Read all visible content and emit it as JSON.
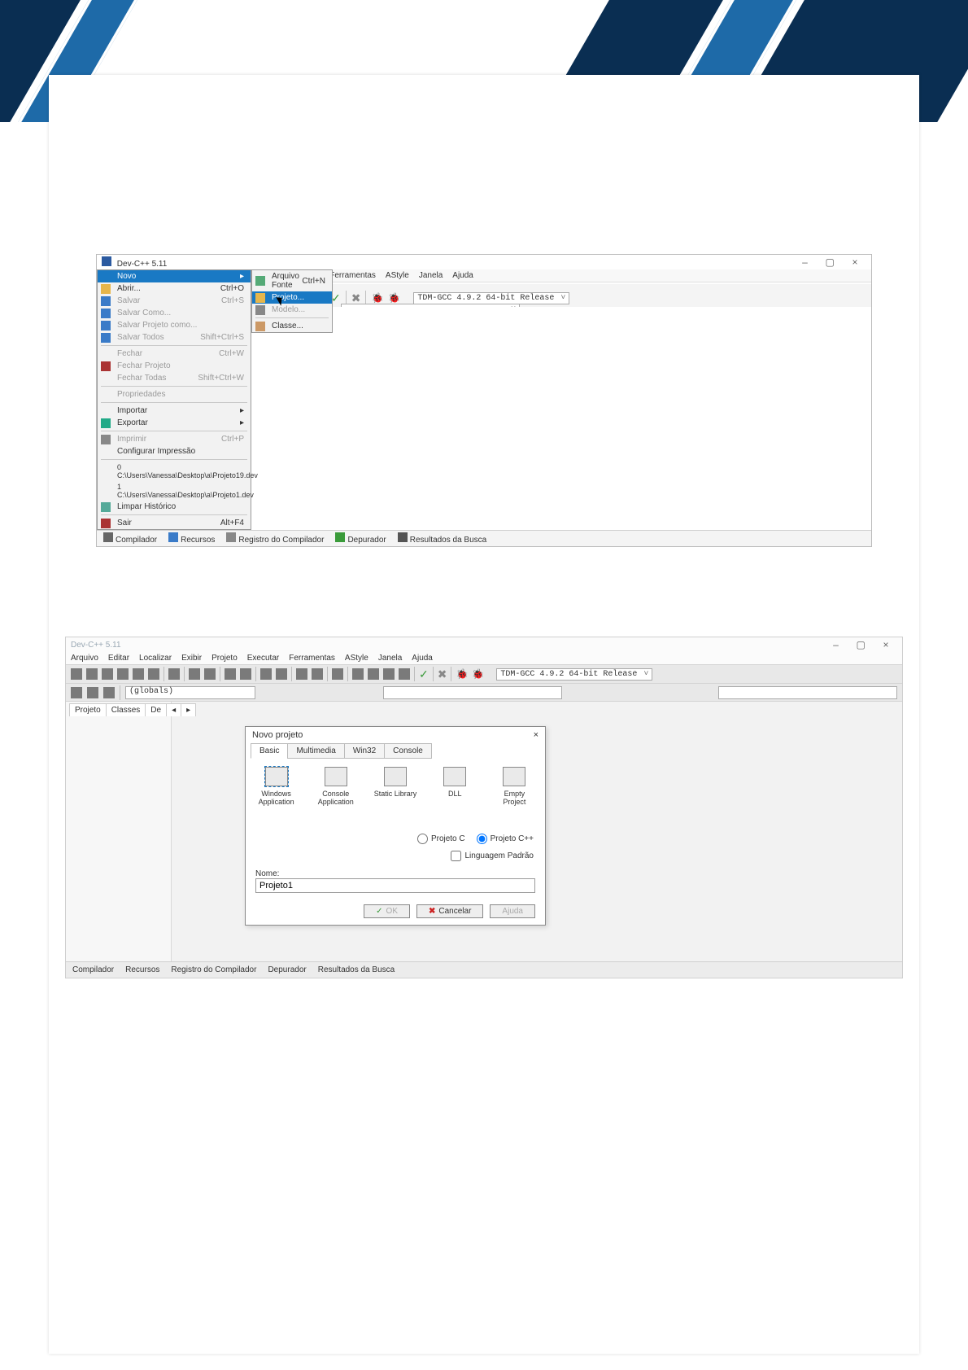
{
  "app_title": "Dev-C++ 5.11",
  "window_controls": {
    "min": "–",
    "max": "▢",
    "close": "×"
  },
  "menus": [
    "Arquivo",
    "Editar",
    "Localizar",
    "Exibir",
    "Projeto",
    "Executar",
    "Ferramentas",
    "AStyle",
    "Janela",
    "Ajuda"
  ],
  "compiler_selector": "TDM-GCC 4.9.2 64-bit Release",
  "bottom_tabs": [
    "Compilador",
    "Recursos",
    "Registro do Compilador",
    "Depurador",
    "Resultados da Busca"
  ],
  "file_menu": {
    "novo": "Novo",
    "abrir": "Abrir...",
    "abrir_sc": "Ctrl+O",
    "salvar": "Salvar",
    "salvar_sc": "Ctrl+S",
    "salvar_como": "Salvar Como...",
    "salvar_proj": "Salvar Projeto como...",
    "salvar_todos": "Salvar Todos",
    "salvar_todos_sc": "Shift+Ctrl+S",
    "fechar": "Fechar",
    "fechar_sc": "Ctrl+W",
    "fechar_proj": "Fechar Projeto",
    "fechar_todos": "Fechar Todas",
    "fechar_todos_sc": "Shift+Ctrl+W",
    "propriedades": "Propriedades",
    "importar": "Importar",
    "exportar": "Exportar",
    "imprimir": "Imprimir",
    "imprimir_sc": "Ctrl+P",
    "conf_impr": "Configurar Impressão",
    "recent0": "0 C:\\Users\\Vanessa\\Desktop\\a\\Projeto19.dev",
    "recent1": "1 C:\\Users\\Vanessa\\Desktop\\a\\Projeto1.dev",
    "limpar": "Limpar Histórico",
    "sair": "Sair",
    "sair_sc": "Alt+F4"
  },
  "novo_submenu": {
    "arquivo_fonte": "Arquivo Fonte",
    "arquivo_fonte_sc": "Ctrl+N",
    "projeto": "Projeto...",
    "modelo": "Modelo...",
    "classe": "Classe..."
  },
  "shot2": {
    "globals_label": "(globals)",
    "left_tabs": [
      "Projeto",
      "Classes",
      "De"
    ],
    "dialog": {
      "title": "Novo projeto",
      "tabs": [
        "Basic",
        "Multimedia",
        "Win32",
        "Console"
      ],
      "types": [
        "Windows Application",
        "Console Application",
        "Static Library",
        "DLL",
        "Empty Project"
      ],
      "opt_c": "Projeto C",
      "opt_cpp": "Projeto C++",
      "lang_default": "Linguagem Padrão",
      "name_label": "Nome:",
      "name_value": "Projeto1",
      "btn_ok": "OK",
      "btn_cancel": "Cancelar",
      "btn_help": "Ajuda"
    }
  }
}
